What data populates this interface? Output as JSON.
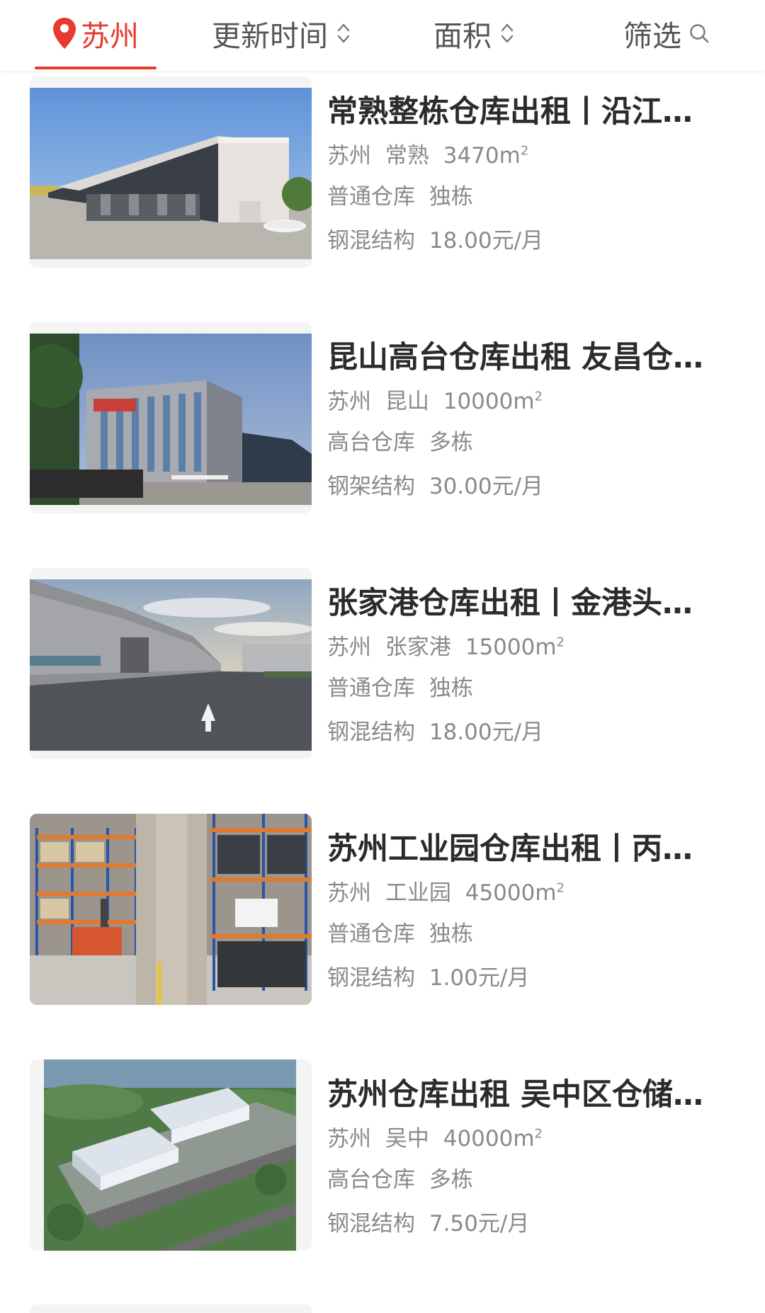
{
  "filter_bar": {
    "city": "苏州",
    "sort_time_label": "更新时间",
    "sort_area_label": "面积",
    "filter_label": "筛选"
  },
  "colors": {
    "accent": "#e63b2e",
    "title_text": "#2b2b2b",
    "meta_text": "#8a8a8a"
  },
  "listings": [
    {
      "title": "常熟整栋仓库出租丨沿江高速附近",
      "city": "苏州",
      "district": "常熟",
      "area": "3470m",
      "area_unit_sup": "2",
      "warehouse_type": "普通仓库",
      "building": "独栋",
      "structure": "钢混结构",
      "price": "18.00元/月",
      "image": "warehouse-exterior-photo"
    },
    {
      "title": "昆山高台仓库出租 友昌仓储物流园",
      "city": "苏州",
      "district": "昆山",
      "area": "10000m",
      "area_unit_sup": "2",
      "warehouse_type": "高台仓库",
      "building": "多栋",
      "structure": "钢架结构",
      "price": "30.00元/月",
      "image": "office-building-photo"
    },
    {
      "title": "张家港仓库出租丨金港头厂房仓库",
      "city": "苏州",
      "district": "张家港",
      "area": "15000m",
      "area_unit_sup": "2",
      "warehouse_type": "普通仓库",
      "building": "独栋",
      "structure": "钢混结构",
      "price": "18.00元/月",
      "image": "warehouse-road-photo"
    },
    {
      "title": "苏州工业园仓库出租丨丙二类仓库",
      "city": "苏州",
      "district": "工业园",
      "area": "45000m",
      "area_unit_sup": "2",
      "warehouse_type": "普通仓库",
      "building": "独栋",
      "structure": "钢混结构",
      "price": "1.00元/月",
      "image": "warehouse-interior-racks-photo"
    },
    {
      "title": "苏州仓库出租 吴中区仓储物流园",
      "city": "苏州",
      "district": "吴中",
      "area": "40000m",
      "area_unit_sup": "2",
      "warehouse_type": "高台仓库",
      "building": "多栋",
      "structure": "钢混结构",
      "price": "7.50元/月",
      "image": "aerial-rendering-photo"
    }
  ]
}
